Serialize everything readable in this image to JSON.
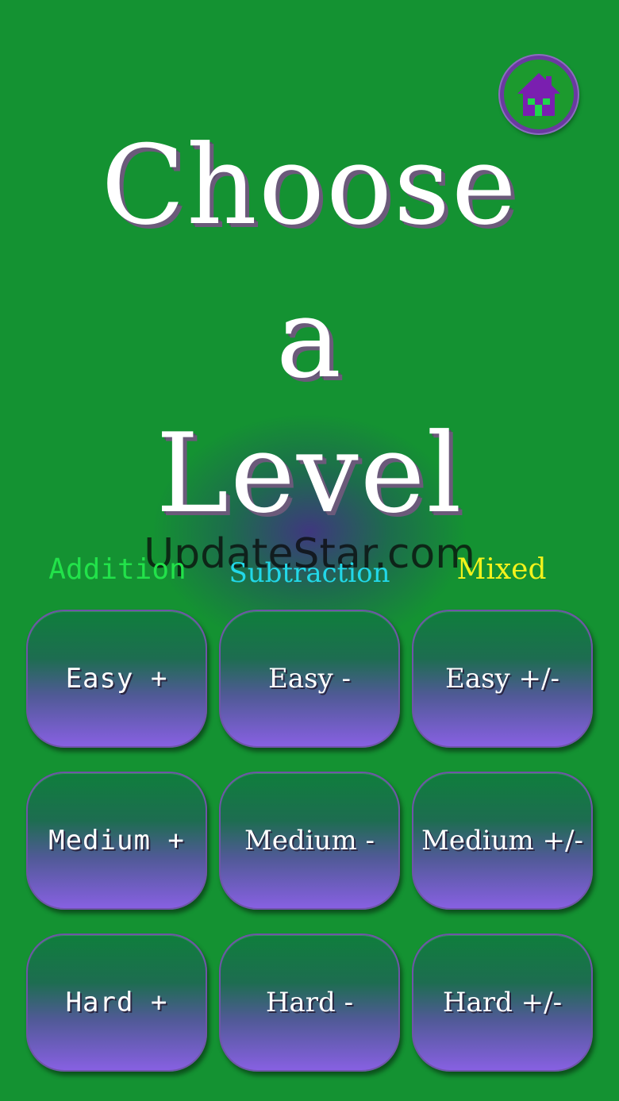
{
  "title": {
    "line1": "Choose",
    "line2": "a",
    "line3": "Level"
  },
  "watermark": "UpdateStar.com",
  "columns": {
    "addition": "Addition",
    "subtraction": "Subtraction",
    "mixed": "Mixed"
  },
  "buttons": {
    "easy_add": "Easy +",
    "easy_sub": "Easy -",
    "easy_mix": "Easy +/-",
    "medium_add": "Medium +",
    "medium_sub": "Medium -",
    "medium_mix": "Medium +/-",
    "hard_add": "Hard +",
    "hard_sub": "Hard -",
    "hard_mix": "Hard +/-"
  },
  "home": {
    "icon": "home-icon"
  },
  "colors": {
    "background": "#149232",
    "addition": "#22e24a",
    "subtraction": "#22d8e8",
    "mixed": "#f2f21c",
    "button_top": "#0f7e3c",
    "button_bottom": "#8760e2",
    "home_icon": "#7a1fb0"
  }
}
